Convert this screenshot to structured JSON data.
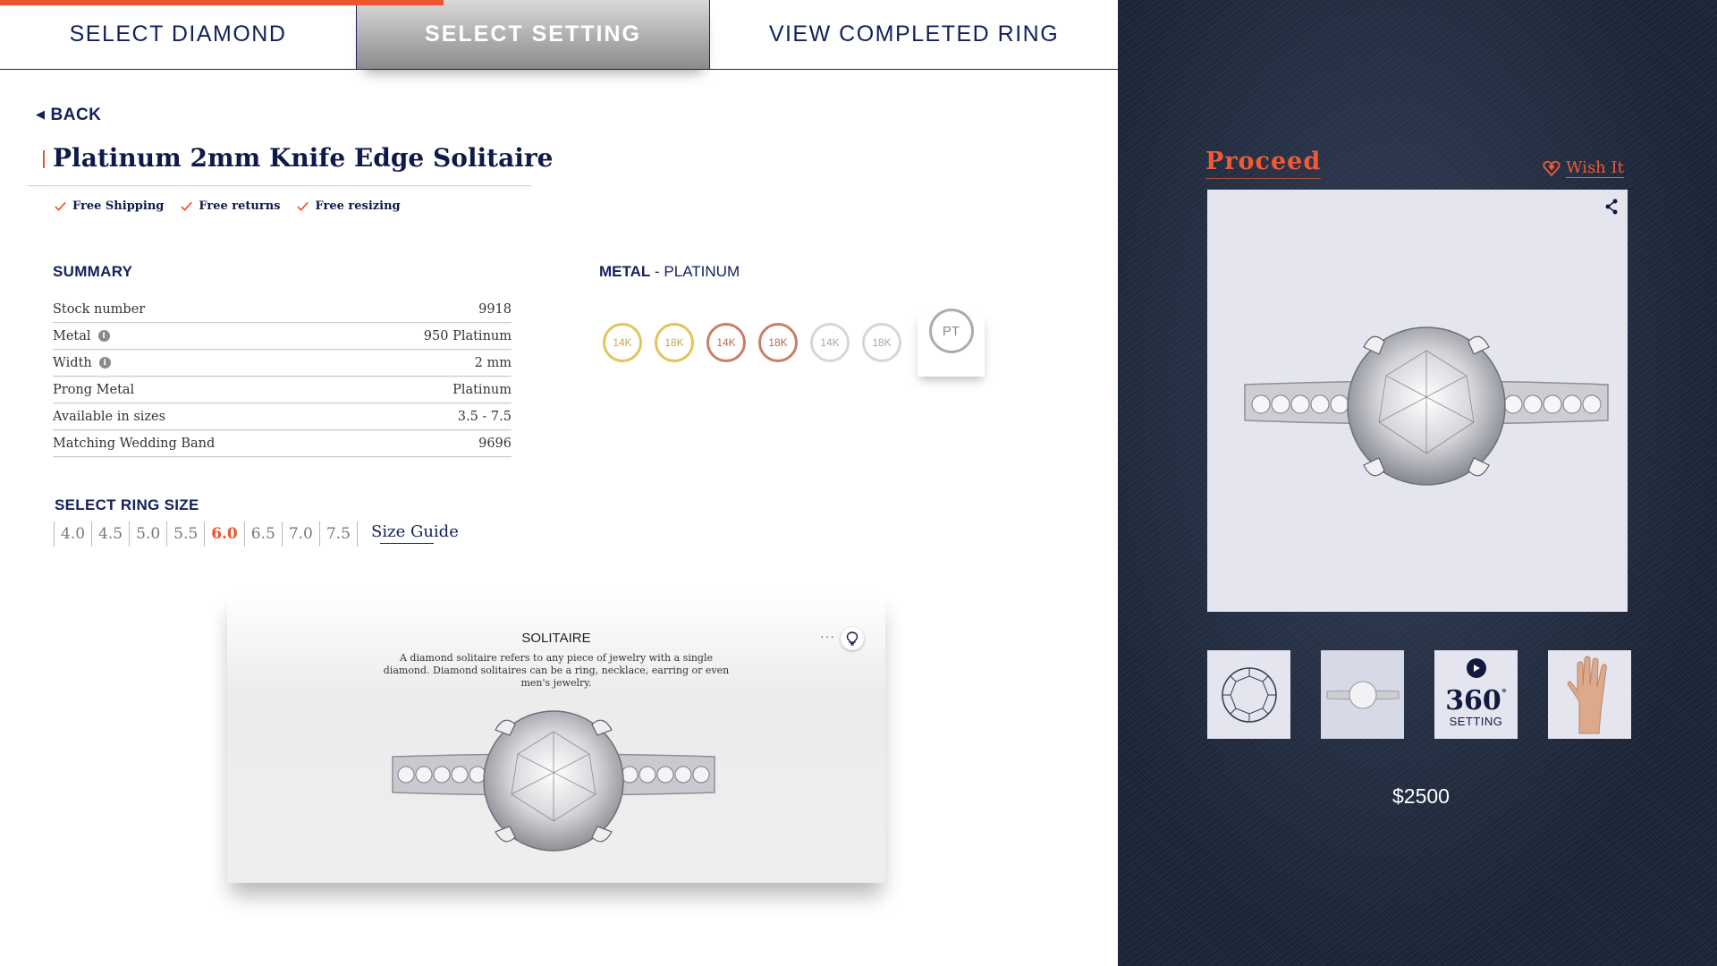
{
  "steps": {
    "select_diamond": "SELECT DIAMOND",
    "select_setting": "SELECT SETTING",
    "view_completed": "VIEW COMPLETED RING"
  },
  "back_label": "BACK",
  "product_title": "Platinum 2mm Knife Edge Solitaire",
  "perks": [
    "Free Shipping",
    "Free returns",
    "Free resizing"
  ],
  "summary": {
    "heading": "SUMMARY",
    "rows": [
      {
        "label": "Stock number",
        "value": "9918",
        "info": false
      },
      {
        "label": "Metal",
        "value": "950 Platinum",
        "info": true
      },
      {
        "label": "Width",
        "value": "2 mm",
        "info": true
      },
      {
        "label": "Prong Metal",
        "value": "Platinum",
        "info": false
      },
      {
        "label": "Available in sizes",
        "value": "3.5 - 7.5",
        "info": false
      },
      {
        "label": "Matching Wedding Band",
        "value": "9696",
        "info": false
      }
    ]
  },
  "metal": {
    "heading": "METAL",
    "selected_name": "PLATINUM",
    "options": [
      {
        "label": "14K",
        "tone": "yellow"
      },
      {
        "label": "18K",
        "tone": "yellow"
      },
      {
        "label": "14K",
        "tone": "rose"
      },
      {
        "label": "18K",
        "tone": "rose"
      },
      {
        "label": "14K",
        "tone": "white"
      },
      {
        "label": "18K",
        "tone": "white"
      },
      {
        "label": "PT",
        "tone": "platinum",
        "selected": true
      }
    ]
  },
  "ring_size": {
    "heading": "SELECT RING SIZE",
    "sizes": [
      "4.0",
      "4.5",
      "5.0",
      "5.5",
      "6.0",
      "6.5",
      "7.0",
      "7.5"
    ],
    "selected": "6.0",
    "guide_label": "Size Guide"
  },
  "info_card": {
    "title": "SOLITAIRE",
    "description": "A diamond solitaire refers to any piece of jewelry with a single diamond. Diamond solitaires can be a ring, necklace, earring or even men's jewelry.",
    "more_label": "···"
  },
  "right_panel": {
    "proceed_label": "Proceed",
    "wish_label": "Wish It",
    "thumb_360": {
      "number": "360",
      "degree": "°",
      "label": "SETTING"
    },
    "price": "$2500"
  },
  "colors": {
    "accent": "#f1522f",
    "navy": "#13205a",
    "right_bg": "#1b2436",
    "image_bg": "#e4e5ee"
  }
}
